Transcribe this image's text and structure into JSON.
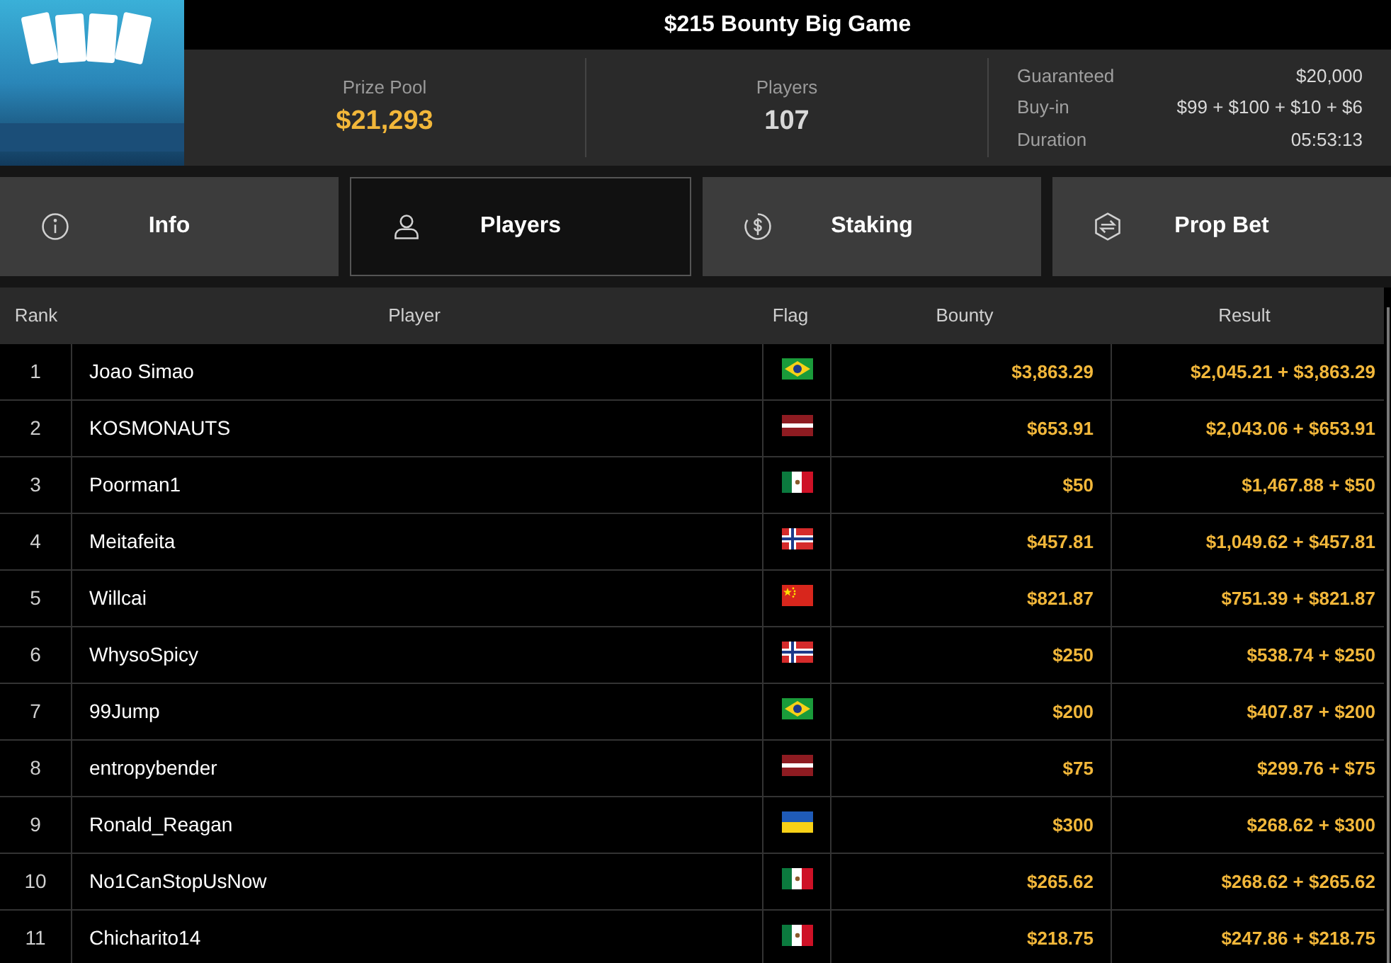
{
  "title": "$215 Bounty Big Game",
  "stats": [
    {
      "label": "Prize Pool",
      "value": "$21,293",
      "kind": "highlight"
    },
    {
      "label": "Players",
      "value": "107",
      "kind": "plain"
    }
  ],
  "details": [
    {
      "label": "Guaranteed",
      "value": "$20,000"
    },
    {
      "label": "Buy-in",
      "value": "$99 + $100 + $10 + $6"
    },
    {
      "label": "Duration",
      "value": "05:53:13"
    }
  ],
  "tabs": [
    {
      "label": "Info",
      "kind": "info",
      "selected": false
    },
    {
      "label": "Players",
      "kind": "user",
      "selected": true
    },
    {
      "label": "Staking",
      "kind": "dollar",
      "selected": false
    },
    {
      "label": "Prop Bet",
      "kind": "hexagon",
      "selected": false
    }
  ],
  "table": {
    "columns": [
      "Rank",
      "Player",
      "Flag",
      "Bounty",
      "Result"
    ],
    "rows": [
      {
        "rank": "1",
        "player": "Joao Simao",
        "kind": "brazil",
        "bounty": "$3,863.29",
        "result": "$2,045.21 + $3,863.29"
      },
      {
        "rank": "2",
        "player": "KOSMONAUTS",
        "kind": "latvia",
        "bounty": "$653.91",
        "result": "$2,043.06 + $653.91"
      },
      {
        "rank": "3",
        "player": "Poorman1",
        "kind": "mexico",
        "bounty": "$50",
        "result": "$1,467.88 + $50"
      },
      {
        "rank": "4",
        "player": "Meitafeita",
        "kind": "norway",
        "bounty": "$457.81",
        "result": "$1,049.62 + $457.81"
      },
      {
        "rank": "5",
        "player": "Willcai",
        "kind": "china",
        "bounty": "$821.87",
        "result": "$751.39 + $821.87"
      },
      {
        "rank": "6",
        "player": "WhysoSpicy",
        "kind": "norway",
        "bounty": "$250",
        "result": "$538.74 + $250"
      },
      {
        "rank": "7",
        "player": "99Jump",
        "kind": "brazil",
        "bounty": "$200",
        "result": "$407.87 + $200"
      },
      {
        "rank": "8",
        "player": "entropybender",
        "kind": "latvia",
        "bounty": "$75",
        "result": "$299.76 + $75"
      },
      {
        "rank": "9",
        "player": "Ronald_Reagan",
        "kind": "ukraine",
        "bounty": "$300",
        "result": "$268.62 + $300"
      },
      {
        "rank": "10",
        "player": "No1CanStopUsNow",
        "kind": "mexico",
        "bounty": "$265.62",
        "result": "$268.62 + $265.62"
      },
      {
        "rank": "11",
        "player": "Chicharito14",
        "kind": "mexico",
        "bounty": "$218.75",
        "result": "$247.86 + $218.75"
      }
    ]
  }
}
